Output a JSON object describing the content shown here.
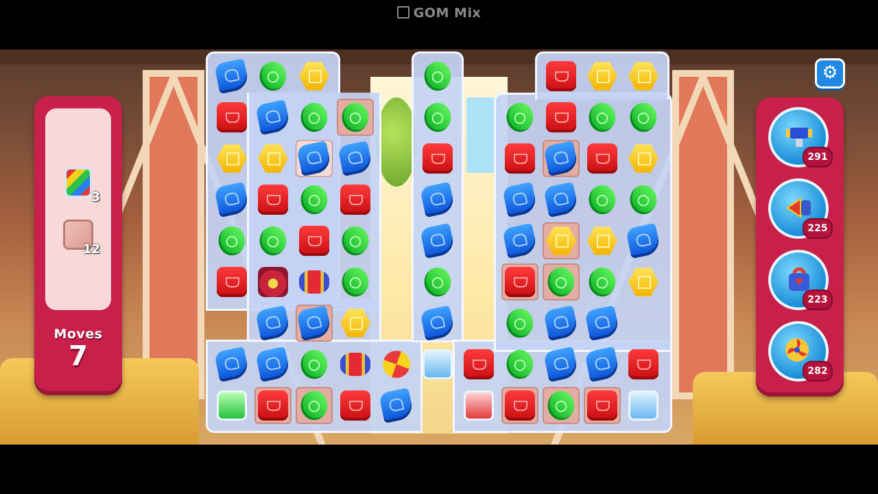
{
  "watermark": {
    "text": "GOM Mix"
  },
  "goals": {
    "items": [
      {
        "icon": "rainbow-jar-icon",
        "count": "3"
      },
      {
        "icon": "pink-tile-icon",
        "count": "12"
      }
    ],
    "moves_label": "Moves",
    "moves_value": "7"
  },
  "boosters": [
    {
      "icon": "cannon-icon",
      "count": "291"
    },
    {
      "icon": "drill-icon",
      "count": "225"
    },
    {
      "icon": "weight-icon",
      "count": "223"
    },
    {
      "icon": "fan-icon",
      "count": "282"
    }
  ],
  "settings": {
    "icon": "gear-icon"
  },
  "board": {
    "columns": 11,
    "rows": 9,
    "grid": [
      [
        "blue",
        "green",
        "yellow",
        "",
        "",
        "green",
        "",
        "",
        "red",
        "yellow",
        "yellow"
      ],
      [
        "red",
        "blue",
        "green",
        "green",
        "",
        "green",
        "",
        "green",
        "red",
        "green",
        "green"
      ],
      [
        "yellow",
        "yellow",
        "blue",
        "blue",
        "",
        "red",
        "",
        "red",
        "blue",
        "red",
        "yellow"
      ],
      [
        "blue",
        "red",
        "green",
        "red",
        "",
        "blue",
        "",
        "blue",
        "blue",
        "green",
        "green"
      ],
      [
        "green",
        "green",
        "red",
        "green",
        "",
        "blue",
        "",
        "blue",
        "yellow",
        "yellow",
        "blue"
      ],
      [
        "red",
        "bomb",
        "rocket",
        "green",
        "",
        "green",
        "",
        "red",
        "green",
        "green",
        "yellow"
      ],
      [
        "",
        "blue",
        "blue",
        "yellow",
        "",
        "blue",
        "",
        "green",
        "blue",
        "blue",
        ""
      ],
      [
        "blue",
        "blue",
        "green",
        "rocket",
        "propeller",
        "jar-blue",
        "red",
        "green",
        "blue",
        "blue",
        "red"
      ],
      [
        "jar-green",
        "red",
        "green",
        "red",
        "blue",
        "",
        "jar-red",
        "red",
        "green",
        "red",
        "jar-blue"
      ]
    ],
    "tiles": [
      [
        1,
        3
      ],
      [
        2,
        2
      ],
      [
        5,
        7
      ],
      [
        5,
        8
      ],
      [
        4,
        8
      ],
      [
        2,
        8
      ],
      [
        6,
        2
      ],
      [
        8,
        1
      ],
      [
        8,
        2
      ],
      [
        8,
        7
      ],
      [
        8,
        8
      ],
      [
        8,
        9
      ]
    ],
    "selected": [
      [
        2,
        2
      ]
    ]
  }
}
